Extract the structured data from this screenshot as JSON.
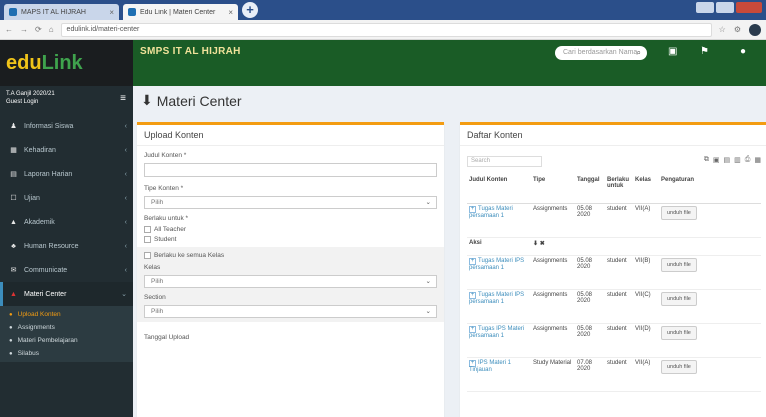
{
  "browser": {
    "tabs": [
      {
        "label": "MAPS IT AL HIJRAH",
        "active": false
      },
      {
        "label": "Edu Link | Materi Center",
        "active": true
      }
    ],
    "new_tab": "+",
    "url": "edulink.id/materi-center",
    "nav": {
      "back": "←",
      "forward": "→",
      "reload": "⟳",
      "home": "⌂"
    }
  },
  "header": {
    "logo_edu": "edu",
    "logo_link": "Link",
    "school_name": "SMPS IT AL HIJRAH",
    "search_placeholder": "Cari berdasarkan Nama",
    "search_icon": "search-icon",
    "icons": [
      "message-icon",
      "flag-icon",
      "user-icon"
    ],
    "accent": "#1a5c26"
  },
  "sidebar": {
    "user_line1": "T.A Ganjil 2020/21",
    "user_line2": "Guest Login",
    "items": [
      {
        "label": "Informasi Siswa",
        "icon": "users-icon"
      },
      {
        "label": "Kehadiran",
        "icon": "calendar-icon"
      },
      {
        "label": "Laporan Harian",
        "icon": "book-icon"
      },
      {
        "label": "Ujian",
        "icon": "exam-icon"
      },
      {
        "label": "Akademik",
        "icon": "graduation-icon"
      },
      {
        "label": "Human Resource",
        "icon": "people-icon"
      },
      {
        "label": "Communicate",
        "icon": "chat-icon"
      },
      {
        "label": "Materi Center",
        "icon": "download-icon",
        "active": true
      }
    ],
    "subitems": [
      {
        "label": "Upload Konten",
        "active": true
      },
      {
        "label": "Assignments",
        "active": false
      },
      {
        "label": "Materi Pembelajaran",
        "active": false
      },
      {
        "label": "Silabus",
        "active": false
      }
    ]
  },
  "page": {
    "title": "Materi Center"
  },
  "upload": {
    "title": "Upload Konten",
    "judul_label": "Judul Konten *",
    "tipe_label": "Tipe Konten *",
    "tipe_value": "Pilih",
    "berlaku_label": "Berlaku untuk *",
    "check_teacher": "All Teacher",
    "check_student": "Student",
    "check_all_class": "Berlaku ke semua Kelas",
    "kelas_label": "Kelas",
    "kelas_value": "Pilih",
    "section_label": "Section",
    "section_value": "Pilih",
    "tanggal_label": "Tanggal Upload"
  },
  "daftar": {
    "title": "Daftar Konten",
    "search_placeholder": "Search",
    "columns": [
      "Judul Konten",
      "Tipe",
      "Tanggal",
      "Berlaku untuk",
      "Kelas",
      "Pengaturan"
    ],
    "subhead": {
      "label": "Aksi"
    },
    "rows": [
      {
        "judul": "Tugas Materi persamaan 1",
        "tipe": "Assignments",
        "tanggal": "05.08 2020",
        "berlaku": "student",
        "kelas": "VII(A)",
        "aksi": "unduh file"
      },
      {
        "judul": "Tugas Materi IPS persamaan 1",
        "tipe": "Assignments",
        "tanggal": "05.08 2020",
        "berlaku": "student",
        "kelas": "VII(B)",
        "aksi": "unduh file"
      },
      {
        "judul": "Tugas Materi IPS persamaan 1",
        "tipe": "Assignments",
        "tanggal": "05.08 2020",
        "berlaku": "student",
        "kelas": "VII(C)",
        "aksi": "unduh file"
      },
      {
        "judul": "Tugas IPS Materi persamaan 1",
        "tipe": "Assignments",
        "tanggal": "05.08 2020",
        "berlaku": "student",
        "kelas": "VII(D)",
        "aksi": "unduh file"
      },
      {
        "judul": "IPS Materi 1 Tinjauan",
        "tipe": "Study Material",
        "tanggal": "07.08 2020",
        "berlaku": "student",
        "kelas": "VII(A)",
        "aksi": "unduh file"
      }
    ]
  }
}
